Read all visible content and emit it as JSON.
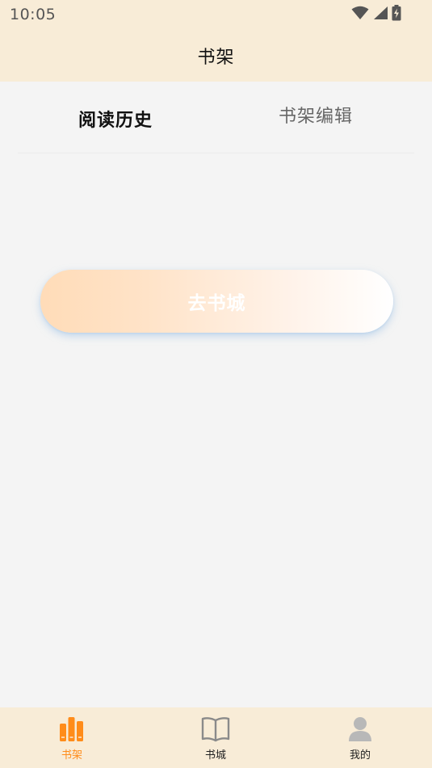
{
  "status_bar": {
    "time": "10:05",
    "icons": [
      "wifi-icon",
      "signal-icon",
      "battery-charging-icon"
    ]
  },
  "header": {
    "title": "书架"
  },
  "tabs": [
    {
      "label": "阅读历史",
      "active": true
    },
    {
      "label": "书架编辑",
      "active": false
    }
  ],
  "main": {
    "go_store_label": "去书城"
  },
  "bottom_nav": {
    "items": [
      {
        "label": "书架",
        "icon": "bookshelf-icon",
        "active": true
      },
      {
        "label": "书城",
        "icon": "open-book-icon",
        "active": false
      },
      {
        "label": "我的",
        "icon": "person-icon",
        "active": false
      }
    ]
  },
  "colors": {
    "header_bg": "#f8ecd7",
    "page_bg": "#f4f4f4",
    "accent": "#ff8c1a",
    "button_gradient_start": "#ffdcb8",
    "button_gradient_end": "#ffffff",
    "inactive_icon": "#8a8a8a"
  }
}
